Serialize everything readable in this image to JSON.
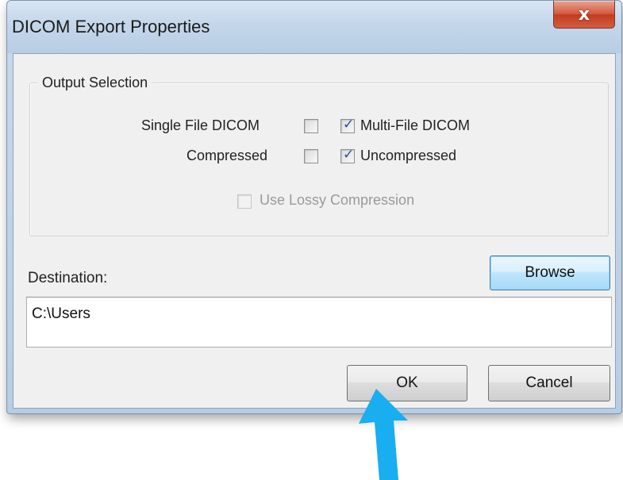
{
  "window": {
    "title": "DICOM Export Properties",
    "close_glyph": "x"
  },
  "output_selection": {
    "label": "Output Selection",
    "single_file_label": "Single File DICOM",
    "single_file_checked": false,
    "multi_file_label": "Multi-File DICOM",
    "multi_file_checked": true,
    "compressed_label": "Compressed",
    "compressed_checked": false,
    "uncompressed_label": "Uncompressed",
    "uncompressed_checked": true,
    "lossy_label": "Use Lossy Compression",
    "lossy_checked": false,
    "lossy_enabled": false
  },
  "destination": {
    "label": "Destination:",
    "value": "C:\\Users",
    "browse_label": "Browse"
  },
  "buttons": {
    "ok_label": "OK",
    "cancel_label": "Cancel"
  },
  "colors": {
    "arrow": "#18aef0",
    "close_button": "#c94a2e"
  },
  "icons": {
    "checkmark": "check-icon",
    "arrow": "arrow-up-icon"
  }
}
